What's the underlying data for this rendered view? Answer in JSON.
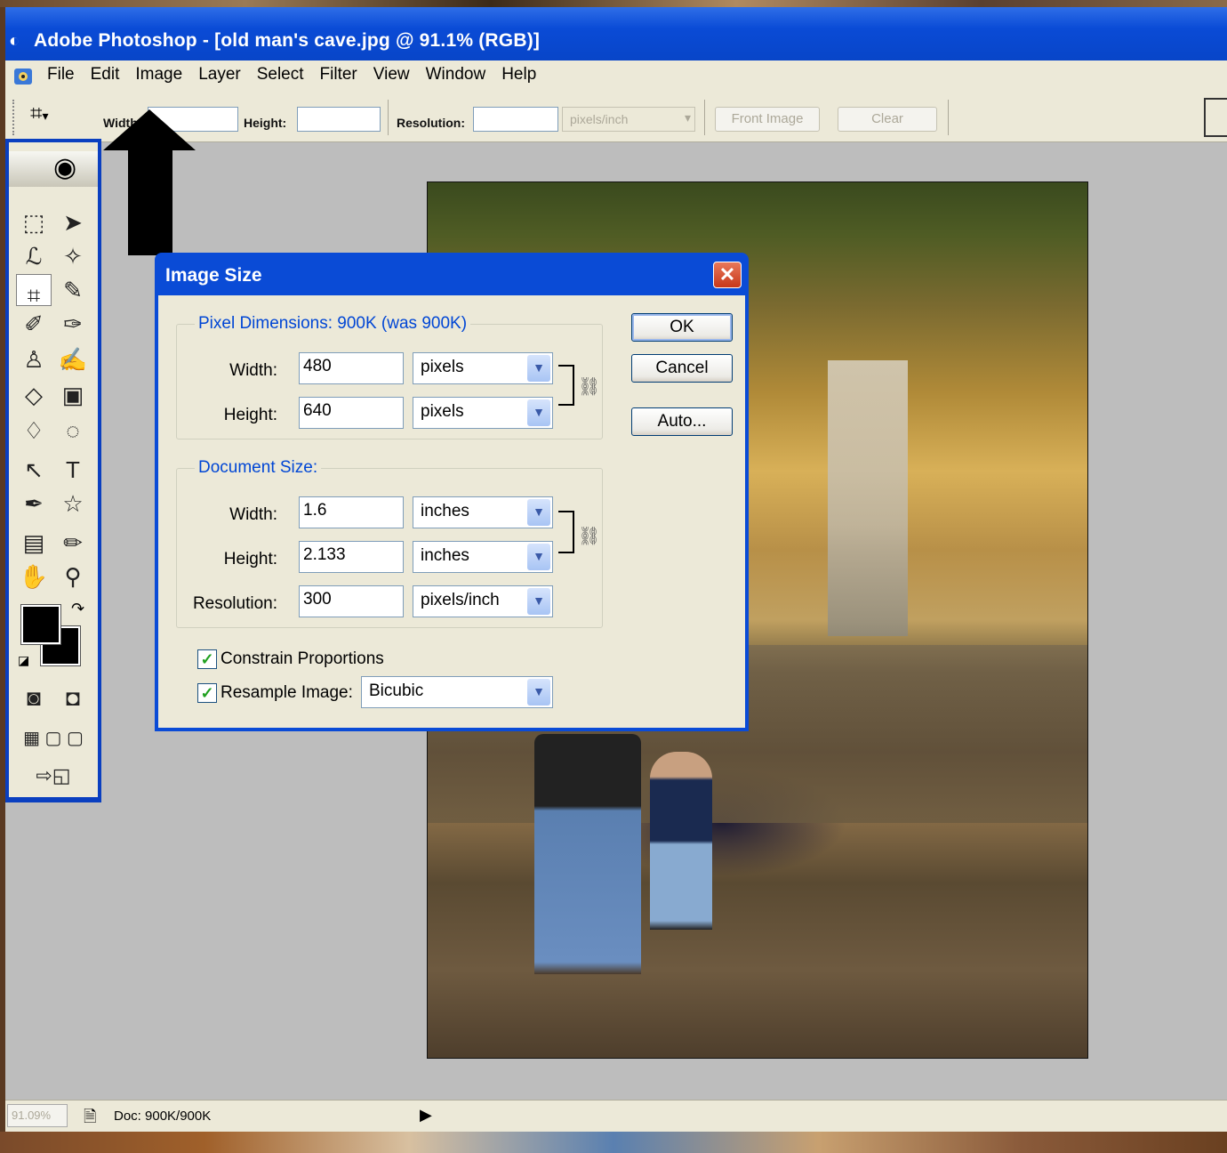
{
  "window": {
    "title": "Adobe Photoshop - [old man's cave.jpg @ 91.1% (RGB)]"
  },
  "menu": [
    "File",
    "Edit",
    "Image",
    "Layer",
    "Select",
    "Filter",
    "View",
    "Window",
    "Help"
  ],
  "options_bar": {
    "width_label": "Width:",
    "height_label": "Height:",
    "resolution_label": "Resolution:",
    "unit": "pixels/inch",
    "front_image": "Front Image",
    "clear": "Clear"
  },
  "dialog": {
    "title": "Image Size",
    "close": "✕",
    "pixel_dimensions": {
      "label": "Pixel Dimensions:  900K (was 900K)",
      "width_label": "Width:",
      "width_value": "480",
      "width_unit": "pixels",
      "height_label": "Height:",
      "height_value": "640",
      "height_unit": "pixels"
    },
    "document_size": {
      "label": "Document Size:",
      "width_label": "Width:",
      "width_value": "1.6",
      "width_unit": "inches",
      "height_label": "Height:",
      "height_value": "2.133",
      "height_unit": "inches",
      "resolution_label": "Resolution:",
      "resolution_value": "300",
      "resolution_unit": "pixels/inch"
    },
    "constrain_label": "Constrain Proportions",
    "constrain_checked": true,
    "resample_label": "Resample Image:",
    "resample_checked": true,
    "resample_method": "Bicubic",
    "buttons": {
      "ok": "OK",
      "cancel": "Cancel",
      "auto": "Auto..."
    }
  },
  "status_bar": {
    "zoom": "91.09%",
    "doc": "Doc: 900K/900K"
  },
  "icons": {
    "app": "photoshop-eye-icon",
    "crop": "crop-icon",
    "check": "✓",
    "dropdown": "chevron-down-icon",
    "link": "chain-link-icon"
  },
  "colors": {
    "titlebar": "#0a4bd6",
    "dialog_bg": "#ece9d8",
    "group_label": "#0046d5"
  }
}
